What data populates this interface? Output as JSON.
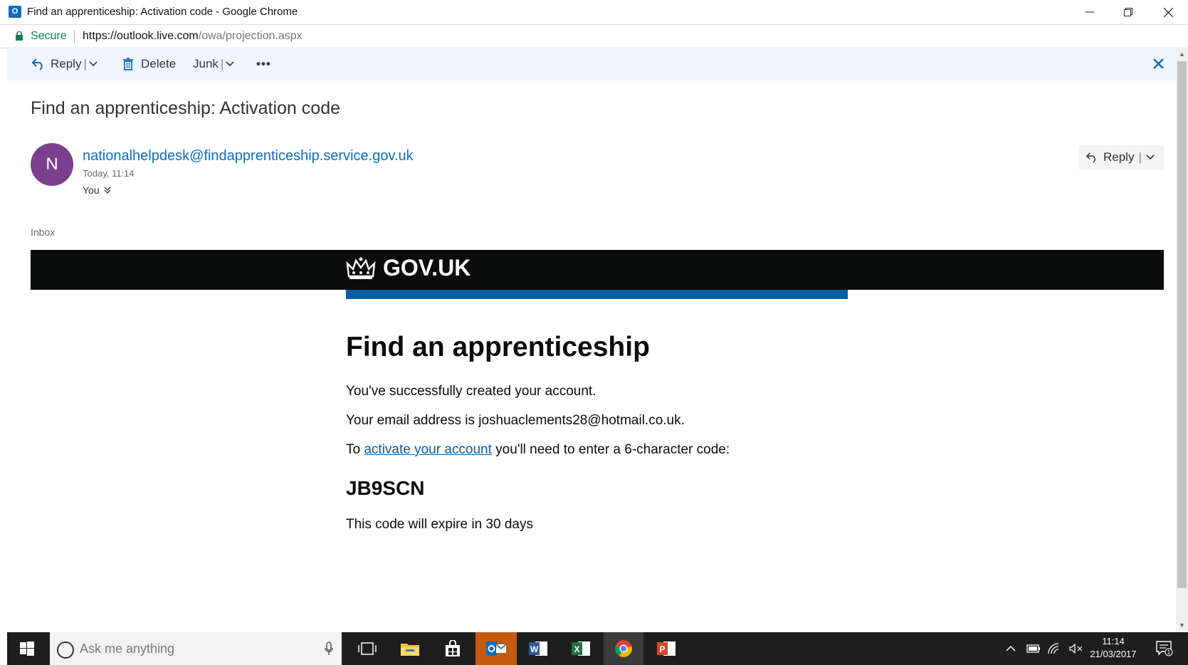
{
  "window": {
    "title": "Find an apprenticeship: Activation code - Google Chrome",
    "app_icon_label": "O"
  },
  "address_bar": {
    "secure_label": "Secure",
    "url_host": "https://outlook.live.com",
    "url_path": "/owa/projection.aspx"
  },
  "toolbar": {
    "reply_label": "Reply",
    "delete_label": "Delete",
    "junk_label": "Junk",
    "more_label": "•••"
  },
  "email": {
    "subject": "Find an apprenticeship: Activation code",
    "avatar_initial": "N",
    "sender": "nationalhelpdesk@findapprenticeship.service.gov.uk",
    "date": "Today, 11:14",
    "recipient": "You",
    "reply_label": "Reply",
    "folder": "Inbox"
  },
  "body": {
    "gov_logo_text": "GOV.UK",
    "heading": "Find an apprenticeship",
    "line1": "You've successfully created your account.",
    "line2": "Your email address is joshuaclements28@hotmail.co.uk.",
    "line3_prefix": "To ",
    "line3_link": "activate your account",
    "line3_suffix": " you'll need to enter a 6-character code:",
    "code": "JB9SCN",
    "expiry": "This code will expire in 30 days"
  },
  "taskbar": {
    "search_placeholder": "Ask me anything",
    "time": "11:14",
    "date": "21/03/2017",
    "notification_count": "1"
  },
  "colors": {
    "owa_blue": "#0f6cbd",
    "gov_black": "#0b0c0c",
    "gov_blue": "#005ea5",
    "avatar_purple": "#7b3f8e"
  }
}
